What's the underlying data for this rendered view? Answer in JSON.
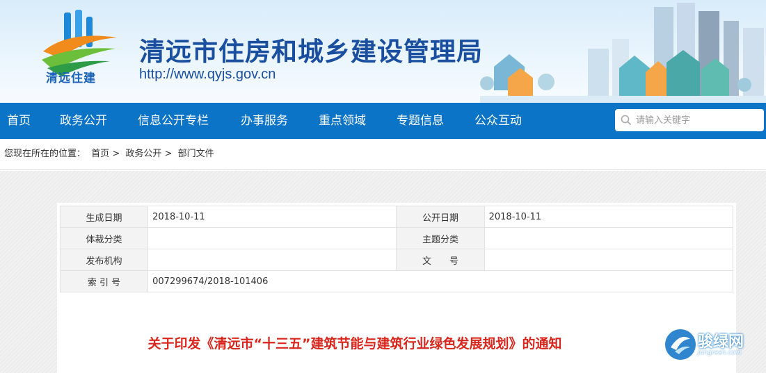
{
  "header": {
    "logo_text": "清远住建",
    "site_title": "清远市住房和城乡建设管理局",
    "site_url": "http://www.qyjs.gov.cn"
  },
  "nav": {
    "items": [
      {
        "label": "首页"
      },
      {
        "label": "政务公开"
      },
      {
        "label": "信息公开专栏"
      },
      {
        "label": "办事服务"
      },
      {
        "label": "重点领域"
      },
      {
        "label": "专题信息"
      },
      {
        "label": "公众互动"
      }
    ],
    "search_placeholder": "请输入关键字"
  },
  "breadcrumb": {
    "prefix": "您现在所在的位置：",
    "items": [
      "首页",
      "政务公开",
      "部门文件"
    ],
    "separator": ">"
  },
  "meta": {
    "rows": [
      {
        "k1": "生成日期",
        "v1": "2018-10-11",
        "k2": "公开日期",
        "v2": "2018-10-11"
      },
      {
        "k1": "体裁分类",
        "v1": "",
        "k2": "主题分类",
        "v2": ""
      },
      {
        "k1": "发布机构",
        "v1": "",
        "k2": "文　　号",
        "v2": ""
      },
      {
        "k1": "索 引 号",
        "v1": "007299674/2018-101406"
      }
    ]
  },
  "document": {
    "title": "关于印发《清远市“十三五”建筑节能与建筑行业绿色发展规划》的通知"
  },
  "watermark": {
    "text": "骏绿网",
    "sub": "Jungreen.com"
  },
  "colors": {
    "nav_bg": "#0b74c6",
    "title_blue": "#1a4fa0",
    "doc_title_red": "#d9261c"
  }
}
